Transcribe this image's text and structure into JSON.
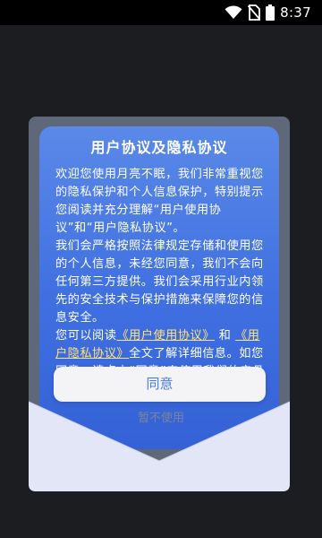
{
  "status_bar": {
    "time": "8:37",
    "icons": [
      "wifi-icon",
      "no-sim-icon",
      "battery-icon"
    ]
  },
  "dialog": {
    "title": "用户协议及隐私协议",
    "paragraph_1": "欢迎您使用月亮不眠，我们非常重视您的隐私保护和个人信息保护，特别提示您阅读并充分理解“用户使用协议”和“用户隐私协议”。",
    "paragraph_2": "我们会严格按照法律规定存储和使用您的个人信息，未经您同意，我们不会向任何第三方提供。我们会采用行业内领先的安全技术与保护措施来保障您的信息安全。",
    "paragraph_3_prefix": "您可以阅读",
    "link_user_agreement": "《用户使用协议》",
    "paragraph_3_and": "和",
    "link_privacy_agreement": "《用户隐私协议》",
    "paragraph_3_suffix": "全文了解详细信息。如您同意，请点击“同意”来使用我们的产品",
    "agree_label": "同意",
    "decline_label": "暂不使用"
  },
  "colors": {
    "letter_top": "#5a89e8",
    "letter_bottom": "#3462d6",
    "link": "#ffe27a",
    "agree_text": "#4a7be4",
    "envelope_body": "#e3e6f6",
    "envelope_back": "#5f6878"
  }
}
